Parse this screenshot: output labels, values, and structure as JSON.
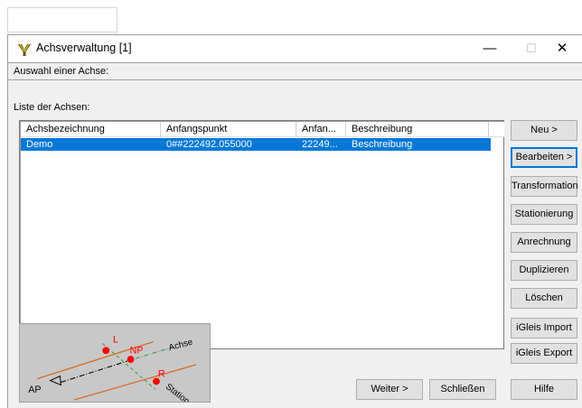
{
  "window": {
    "title": "Achsverwaltung [1]",
    "controls": {
      "minimize": "—",
      "maximize": "☐",
      "close": "✕"
    },
    "app_icon": "app-logo-icon"
  },
  "strip": {
    "label": "Auswahl einer Achse:"
  },
  "list": {
    "label": "Liste der Achsen:",
    "columns": [
      "Achsbezeichnung",
      "Anfangspunkt",
      "Anfan...",
      "Beschreibung"
    ],
    "rows": [
      {
        "name": "Demo",
        "start": "0##222492.055000",
        "anfan": "22249...",
        "desc": "Beschreibung",
        "selected": true
      }
    ]
  },
  "buttons": {
    "neu": "Neu >",
    "bearbeiten": "Bearbeiten >",
    "transformation": "Transformation",
    "stationierung": "Stationierung",
    "anrechnung": "Anrechnung",
    "duplizieren": "Duplizieren",
    "loeschen": "Löschen",
    "igleis_import": "iGleis Import",
    "igleis_export": "iGleis Export",
    "weiter": "Weiter >",
    "schliessen": "Schließen",
    "hilfe": "Hilfe"
  },
  "diagram": {
    "labels": {
      "L": "L",
      "NP": "NP",
      "R": "R",
      "AP": "AP",
      "achse": "Achse",
      "station": "Station"
    },
    "colors": {
      "line": "#d96a20",
      "point": "#ff0000",
      "label_red": "#ff0000",
      "axis_green": "#3a9a3a"
    }
  },
  "colors": {
    "selection": "#0078d7",
    "face": "#f0f0f0"
  }
}
